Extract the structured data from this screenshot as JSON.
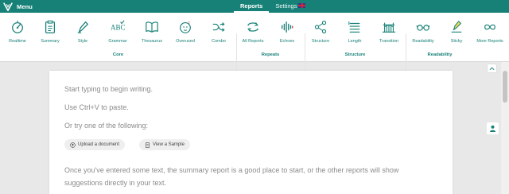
{
  "topbar": {
    "menu_label": "Menu",
    "nav": [
      {
        "label": "Reports",
        "active": true
      },
      {
        "label": "Settings",
        "active": false
      }
    ]
  },
  "toolbar": {
    "tools": [
      {
        "label": "Realtime",
        "icon": "speedometer-icon"
      },
      {
        "label": "Summary",
        "icon": "clipboard-icon"
      },
      {
        "label": "Style",
        "icon": "pen-icon"
      },
      {
        "label": "Grammar",
        "icon": "abc-check-icon"
      },
      {
        "label": "Thesaurus",
        "icon": "open-book-icon"
      },
      {
        "label": "Overused",
        "icon": "sleepy-face-icon"
      },
      {
        "label": "Combo",
        "icon": "shuffle-icon"
      },
      {
        "label": "All Reports",
        "icon": "refresh-arrows-icon"
      },
      {
        "label": "Echoes",
        "icon": "soundwave-icon"
      },
      {
        "label": "Structure",
        "icon": "network-icon"
      },
      {
        "label": "Length",
        "icon": "lines-icon"
      },
      {
        "label": "Transition",
        "icon": "bridge-icon"
      },
      {
        "label": "Readability",
        "icon": "glasses-icon"
      },
      {
        "label": "Sticky",
        "icon": "sticky-pen-icon"
      },
      {
        "label": "More Reports",
        "icon": "infinity-icon"
      }
    ],
    "groups": [
      "Core",
      "Repeats",
      "Structure",
      "Readability"
    ]
  },
  "editor": {
    "hint1": "Start typing to begin writing.",
    "hint2": "Use Ctrl+V to paste.",
    "hint3": "Or try one of the following:",
    "upload_label": "Upload a document",
    "sample_label": "View a Sample",
    "hint4": "Once you've entered some text, the summary report is a good place to start, or the other reports will show",
    "hint5": "suggestions directly in your text."
  },
  "colors": {
    "brand": "#178178",
    "background": "#e8e8e8",
    "hint_text": "#8b8b8b"
  }
}
